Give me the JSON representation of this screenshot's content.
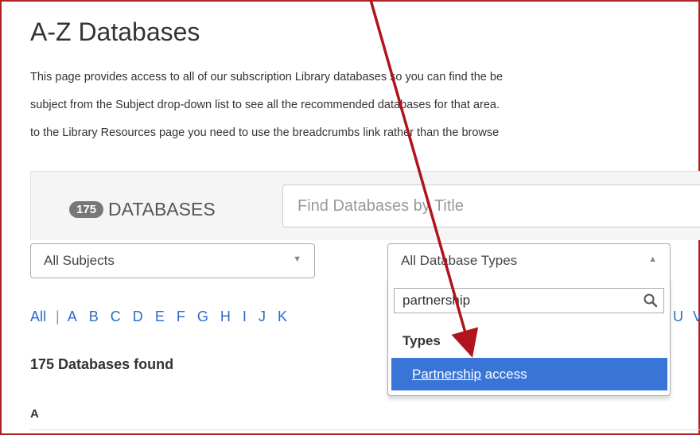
{
  "page": {
    "title": "A-Z Databases",
    "intro_lines": [
      "This page provides access to all of our subscription Library databases so you can find the be",
      "subject from the Subject drop-down list to see all the recommended databases for that area.",
      "to the Library Resources page you need to use the breadcrumbs link rather than the browse"
    ]
  },
  "search": {
    "count": "175",
    "count_label": "DATABASES",
    "placeholder": "Find Databases by Title"
  },
  "filters": {
    "subjects_selected": "All Subjects",
    "types_selected": "All Database Types"
  },
  "dropdown": {
    "search_value": "partnership",
    "group_label": "Types",
    "option_match": "Partnership",
    "option_rest": " access"
  },
  "alphabet": {
    "all": "All",
    "separator": "|",
    "letters": [
      "A",
      "B",
      "C",
      "D",
      "E",
      "F",
      "G",
      "H",
      "I",
      "J",
      "K"
    ],
    "right_letters": [
      "U",
      "V"
    ]
  },
  "results": {
    "found": "175 Databases found",
    "first_letter": "A"
  },
  "colors": {
    "annotation_arrow": "#b0141c",
    "highlight": "#3875d7",
    "link": "#2a6bcc"
  }
}
